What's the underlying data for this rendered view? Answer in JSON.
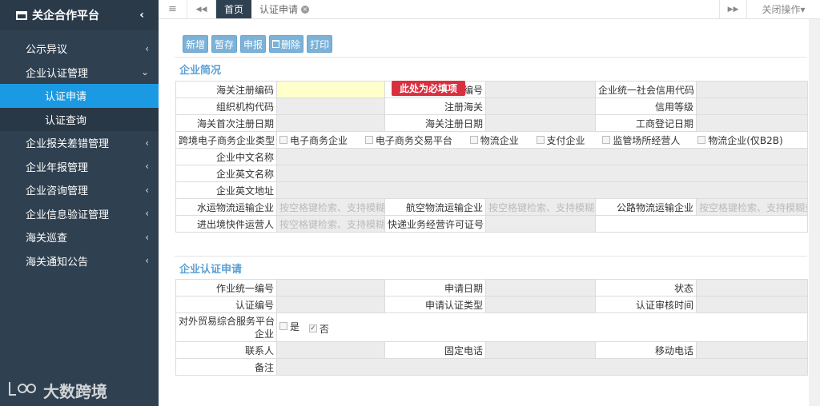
{
  "sidebar": {
    "brand": "关企合作平台",
    "items": [
      {
        "label": "公示异议"
      },
      {
        "label": "企业认证管理"
      },
      {
        "label": "认证申请"
      },
      {
        "label": "认证查询"
      },
      {
        "label": "企业报关差错管理"
      },
      {
        "label": "企业年报管理"
      },
      {
        "label": "企业咨询管理"
      },
      {
        "label": "企业信息验证管理"
      },
      {
        "label": "海关巡查"
      },
      {
        "label": "海关通知公告"
      }
    ]
  },
  "watermark": {
    "icon": "lvb-logo",
    "text": "大数跨境"
  },
  "topbar": {
    "menu_icon": "≡",
    "prev_icon": "◀◀",
    "tabs": [
      {
        "label": "首页"
      },
      {
        "label": "认证申请"
      }
    ],
    "next_icon": "▶▶",
    "close_ops": "关闭操作▾"
  },
  "toolbar": {
    "new": "新增",
    "save": "暂存",
    "submit": "申报",
    "delete": "删除",
    "print": "打印"
  },
  "overview": {
    "title": "企业简况",
    "required_tip": "此处为必填项",
    "row1": {
      "a": "海关注册编码",
      "b": "编号",
      "c": "企业统一社会信用代码"
    },
    "row2": {
      "a": "组织机构代码",
      "b": "注册海关",
      "c": "信用等级"
    },
    "row3": {
      "a": "海关首次注册日期",
      "b": "海关注册日期",
      "c": "工商登记日期"
    },
    "row4": {
      "a": "跨境电子商务企业类型",
      "opts": [
        "电子商务企业",
        "电子商务交易平台",
        "物流企业",
        "支付企业",
        "监管场所经营人",
        "物流企业(仅B2B)"
      ]
    },
    "row5": "企业中文名称",
    "row6": "企业英文名称",
    "row7": "企业英文地址",
    "row8": {
      "a": "水运物流运输企业",
      "b": "航空物流运输企业",
      "c": "公路物流运输企业",
      "ph": "按空格键检索、支持模糊查询"
    },
    "row9": {
      "a": "进出境快件运营人",
      "b": "快递业务经营许可证号",
      "ph": "按空格键检索、支持模糊查询"
    }
  },
  "application": {
    "title": "企业认证申请",
    "r1": {
      "a": "作业统一编号",
      "b": "申请日期",
      "c": "状态"
    },
    "r2": {
      "a": "认证编号",
      "b": "申请认证类型",
      "c": "认证审核时间"
    },
    "r3": {
      "a1": "对外贸易综合服务平台",
      "a2": "企业",
      "yes": "是",
      "no": "否",
      "no_check": "✓"
    },
    "r4": {
      "a": "联系人",
      "b": "固定电话",
      "c": "移动电话"
    },
    "r5": {
      "a": "备注"
    }
  }
}
